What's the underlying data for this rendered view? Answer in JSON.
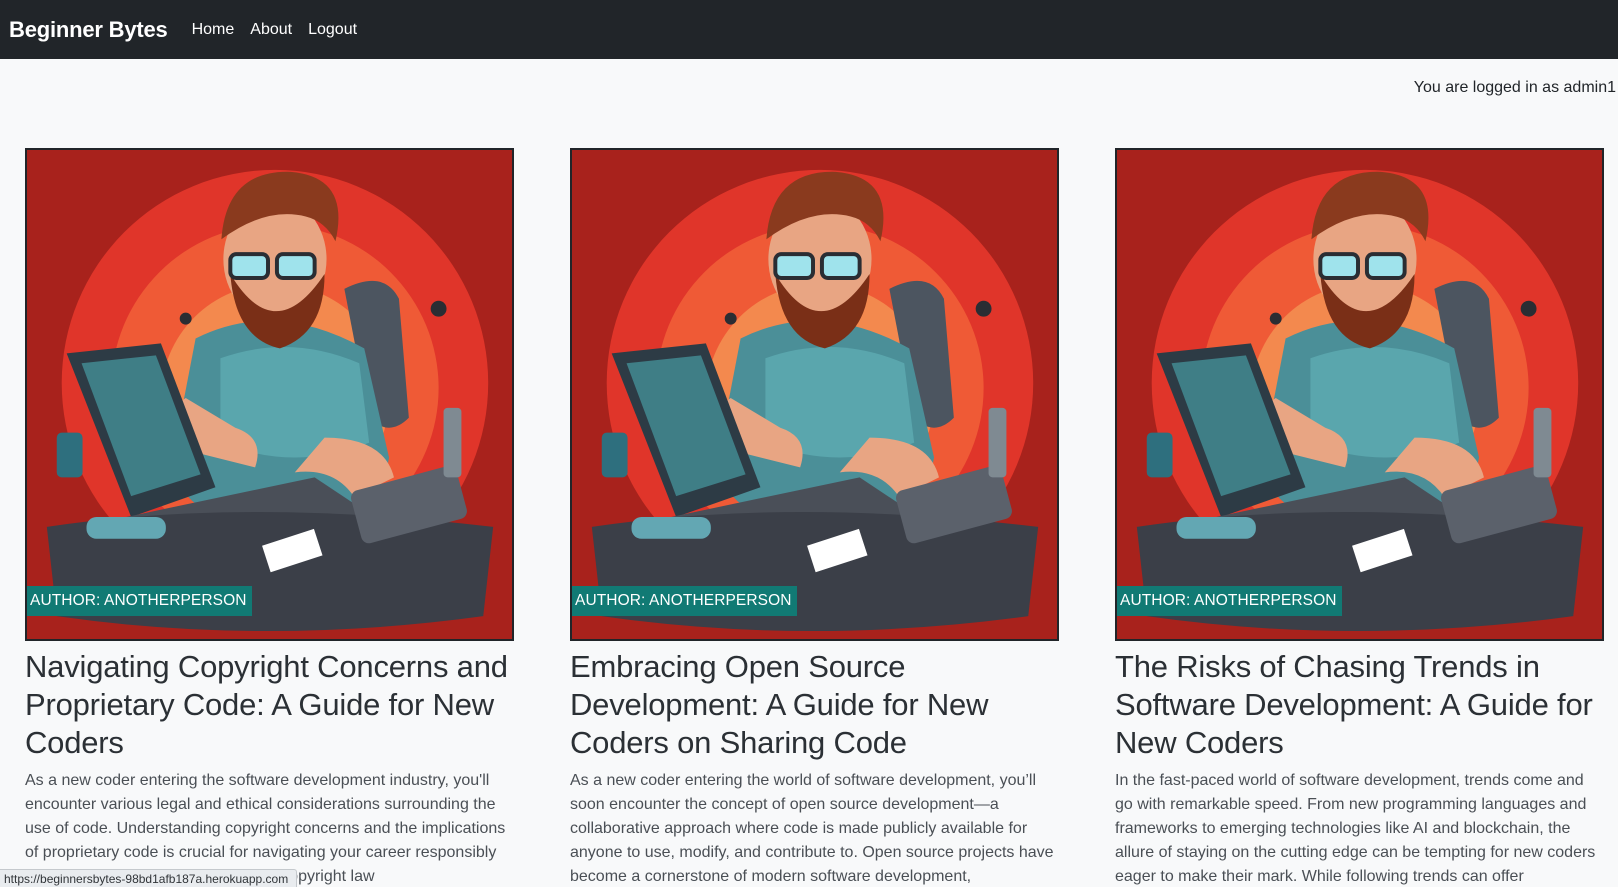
{
  "navbar": {
    "brand": "Beginner Bytes",
    "links": [
      "Home",
      "About",
      "Logout"
    ]
  },
  "login_status": "You are logged in as admin1",
  "posts": [
    {
      "author_badge": "AUTHOR: ANOTHERPERSON",
      "title": "Navigating Copyright Concerns and Proprietary Code: A Guide for New Coders",
      "excerpt": "As a new coder entering the software development industry, you'll encounter various legal and ethical considerations surrounding the use of code. Understanding copyright concerns and the implications of proprietary code is crucial for navigating your career responsibly and avoiding potential legal issues. Copyright law"
    },
    {
      "author_badge": "AUTHOR: ANOTHERPERSON",
      "title": "Embracing Open Source Development: A Guide for New Coders on Sharing Code",
      "excerpt": "As a new coder entering the world of software development, you’ll soon encounter the concept of open source development—a collaborative approach where code is made publicly available for anyone to use, modify, and contribute to. Open source projects have become a cornerstone of modern software development,"
    },
    {
      "author_badge": "AUTHOR: ANOTHERPERSON",
      "title": "The Risks of Chasing Trends in Software Development: A Guide for New Coders",
      "excerpt": "In the fast-paced world of software development, trends come and go with remarkable speed. From new programming languages and frameworks to emerging technologies like AI and blockchain, the allure of staying on the cutting edge can be tempting for new coders eager to make their mark. While following trends can offer"
    }
  ],
  "status_bar_url": "https://beginnersbytes-98bd1afb187a.herokuapp.com",
  "colors": {
    "navbar_bg": "#212529",
    "badge_bg": "#117a74",
    "page_bg": "#f8f9fa"
  }
}
